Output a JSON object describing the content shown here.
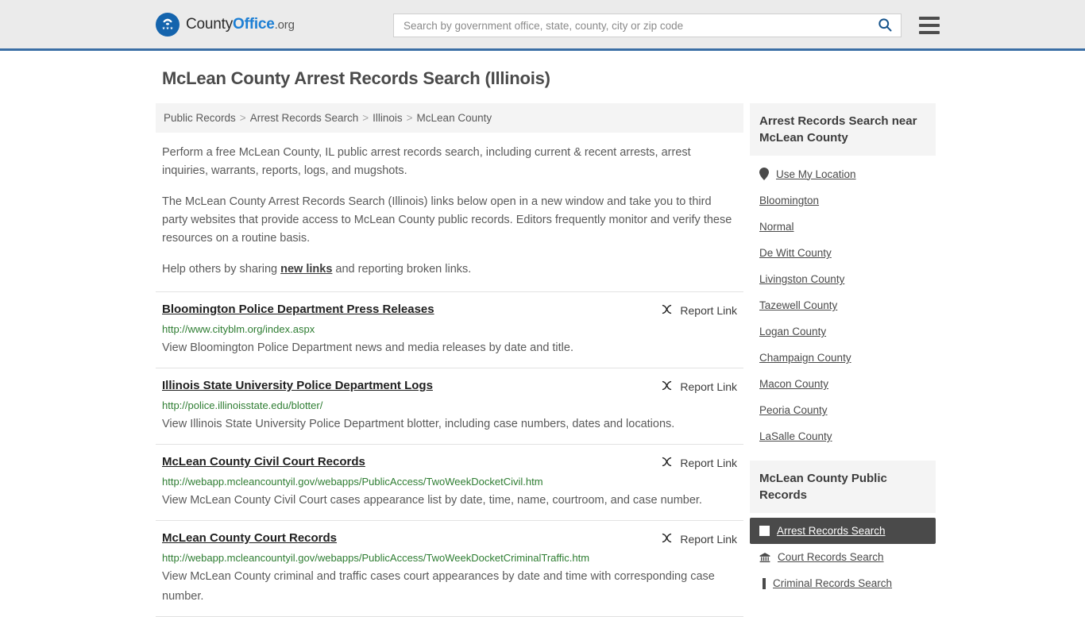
{
  "header": {
    "logo": {
      "part1": "County",
      "part2": "Office",
      "part3": ".org",
      "icon": "eagle-shield-icon"
    },
    "search": {
      "placeholder": "Search by government office, state, county, city or zip code",
      "value": "",
      "button_icon": "search-icon"
    },
    "menu_icon": "hamburger-menu-icon"
  },
  "page": {
    "title": "McLean County Arrest Records Search (Illinois)"
  },
  "breadcrumb": {
    "separator": ">",
    "items": [
      "Public Records",
      "Arrest Records Search",
      "Illinois",
      "McLean County"
    ]
  },
  "intro": {
    "p1": "Perform a free McLean County, IL public arrest records search, including current & recent arrests, arrest inquiries, warrants, reports, logs, and mugshots.",
    "p2": "The McLean County Arrest Records Search (Illinois) links below open in a new window and take you to third party websites that provide access to McLean County public records. Editors frequently monitor and verify these resources on a routine basis.",
    "p3_before": "Help others by sharing ",
    "p3_link": "new links",
    "p3_after": " and reporting broken links."
  },
  "results": {
    "report_label": "Report Link",
    "report_icon": "broken-link-icon",
    "items": [
      {
        "title": "Bloomington Police Department Press Releases",
        "url": "http://www.cityblm.org/index.aspx",
        "desc": "View Bloomington Police Department news and media releases by date and title."
      },
      {
        "title": "Illinois State University Police Department Logs",
        "url": "http://police.illinoisstate.edu/blotter/",
        "desc": "View Illinois State University Police Department blotter, including case numbers, dates and locations."
      },
      {
        "title": "McLean County Civil Court Records",
        "url": "http://webapp.mcleancountyil.gov/webapps/PublicAccess/TwoWeekDocketCivil.htm",
        "desc": "View McLean County Civil Court cases appearance list by date, time, name, courtroom, and case number."
      },
      {
        "title": "McLean County Court Records",
        "url": "http://webapp.mcleancountyil.gov/webapps/PublicAccess/TwoWeekDocketCriminalTraffic.htm",
        "desc": "View McLean County criminal and traffic cases court appearances by date and time with corresponding case number."
      }
    ]
  },
  "sidebar": {
    "nearby": {
      "heading": "Arrest Records Search near McLean County",
      "items": [
        {
          "label": "Use My Location",
          "icon": "map-pin-icon"
        },
        {
          "label": "Bloomington",
          "icon": ""
        },
        {
          "label": "Normal",
          "icon": ""
        },
        {
          "label": "De Witt County",
          "icon": ""
        },
        {
          "label": "Livingston County",
          "icon": ""
        },
        {
          "label": "Tazewell County",
          "icon": ""
        },
        {
          "label": "Logan County",
          "icon": ""
        },
        {
          "label": "Champaign County",
          "icon": ""
        },
        {
          "label": "Macon County",
          "icon": ""
        },
        {
          "label": "Peoria County",
          "icon": ""
        },
        {
          "label": "LaSalle County",
          "icon": ""
        }
      ]
    },
    "public_records": {
      "heading": "McLean County Public Records",
      "items": [
        {
          "label": "Arrest Records Search",
          "icon": "white-square-icon",
          "active": true
        },
        {
          "label": "Court Records Search",
          "icon": "courthouse-icon",
          "active": false
        },
        {
          "label": "Criminal Records Search",
          "icon": "bar-icon",
          "active": false
        }
      ]
    }
  },
  "colors": {
    "header_bg": "#ebebeb",
    "header_border": "#3a6ea5",
    "logo_blue": "#1d7fd4",
    "url_green": "#2e7d32",
    "active_bg": "#4a4a4a",
    "panel_bg": "#f4f4f4"
  }
}
